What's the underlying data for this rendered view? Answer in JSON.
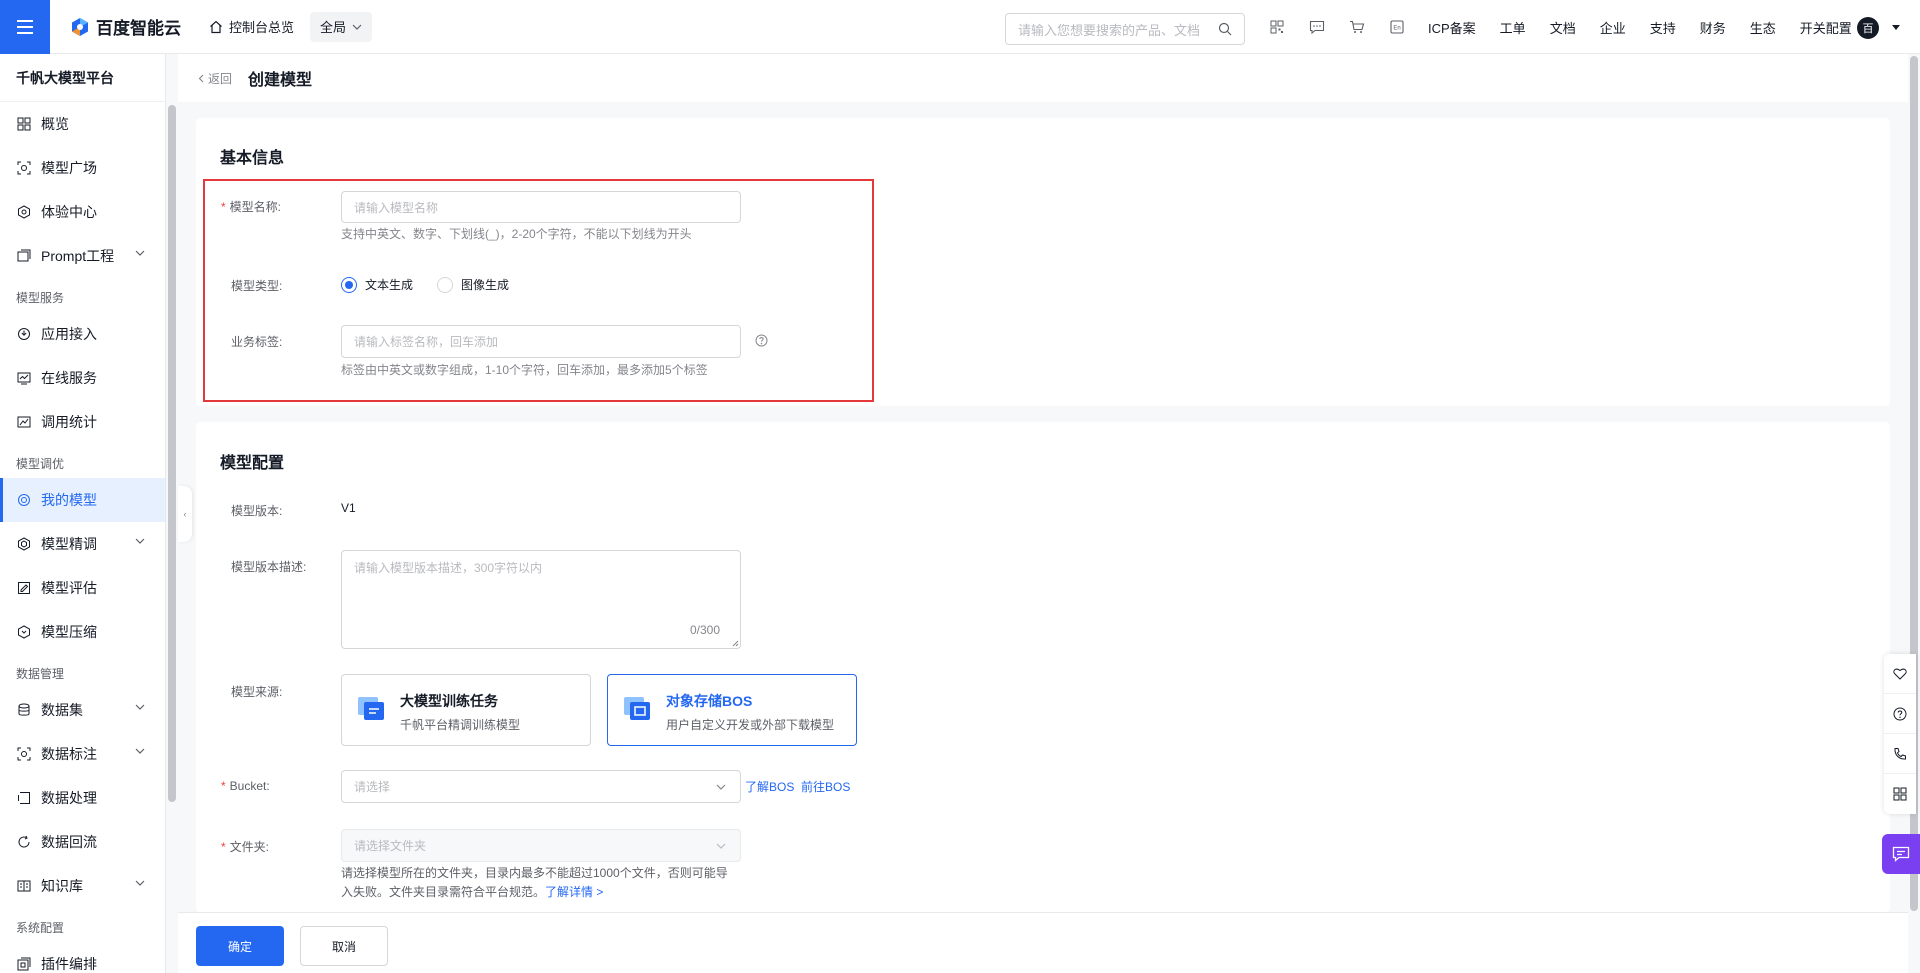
{
  "topbar": {
    "logo_text": "百度智能云",
    "console_label": "控制台总览",
    "scope_value": "全局",
    "search_placeholder": "请输入您想要搜索的产品、文档",
    "nav": [
      "ICP备案",
      "工单",
      "文档",
      "企业",
      "支持",
      "财务",
      "生态",
      "开关配置"
    ],
    "avatar_text": "百",
    "icons": [
      "qrcode-icon",
      "message-icon",
      "cart-icon",
      "language-icon"
    ]
  },
  "sidebar": {
    "title": "千帆大模型平台",
    "items": [
      {
        "label": "概览",
        "icon": "grid-icon"
      },
      {
        "label": "模型广场",
        "icon": "model-square-icon"
      },
      {
        "label": "体验中心",
        "icon": "experience-icon"
      },
      {
        "label": "Prompt工程",
        "icon": "prompt-icon",
        "expandable": true
      }
    ],
    "groups": [
      {
        "label": "模型服务",
        "items": [
          {
            "label": "应用接入",
            "icon": "app-access-icon"
          },
          {
            "label": "在线服务",
            "icon": "online-service-icon"
          },
          {
            "label": "调用统计",
            "icon": "statistics-icon"
          }
        ]
      },
      {
        "label": "模型调优",
        "items": [
          {
            "label": "我的模型",
            "icon": "my-model-icon",
            "active": true
          },
          {
            "label": "模型精调",
            "icon": "fine-tune-icon",
            "expandable": true
          },
          {
            "label": "模型评估",
            "icon": "evaluate-icon"
          },
          {
            "label": "模型压缩",
            "icon": "compress-icon"
          }
        ]
      },
      {
        "label": "数据管理",
        "items": [
          {
            "label": "数据集",
            "icon": "dataset-icon",
            "expandable": true
          },
          {
            "label": "数据标注",
            "icon": "annotation-icon",
            "expandable": true
          },
          {
            "label": "数据处理",
            "icon": "processing-icon"
          },
          {
            "label": "数据回流",
            "icon": "reflow-icon"
          },
          {
            "label": "知识库",
            "icon": "knowledge-icon",
            "expandable": true
          }
        ]
      },
      {
        "label": "系统配置",
        "items": [
          {
            "label": "插件编排",
            "icon": "plugin-icon"
          }
        ]
      }
    ]
  },
  "page": {
    "back_label": "返回",
    "title": "创建模型"
  },
  "basic_info": {
    "title": "基本信息",
    "name_label": "模型名称:",
    "name_placeholder": "请输入模型名称",
    "name_hint": "支持中英文、数字、下划线(_)，2-20个字符，不能以下划线为开头",
    "type_label": "模型类型:",
    "type_options": [
      "文本生成",
      "图像生成"
    ],
    "type_selected": "文本生成",
    "tag_label": "业务标签:",
    "tag_placeholder": "请输入标签名称，回车添加",
    "tag_hint": "标签由中英文或数字组成，1-10个字符，回车添加，最多添加5个标签"
  },
  "model_config": {
    "title": "模型配置",
    "version_label": "模型版本:",
    "version_value": "V1",
    "desc_label": "模型版本描述:",
    "desc_placeholder": "请输入模型版本描述，300字符以内",
    "desc_counter": "0/300",
    "source_label": "模型来源:",
    "sources": [
      {
        "title": "大模型训练任务",
        "desc": "千帆平台精调训练模型",
        "selected": false
      },
      {
        "title": "对象存储BOS",
        "desc": "用户自定义开发或外部下载模型",
        "selected": true
      }
    ],
    "bucket_label": "Bucket:",
    "bucket_placeholder": "请选择",
    "bucket_links": [
      "了解BOS",
      "前往BOS"
    ],
    "folder_label": "文件夹:",
    "folder_placeholder": "请选择文件夹",
    "folder_hint_line1": "请选择模型所在的文件夹，目录内最多不能超过1000个文件，否则可能导",
    "folder_hint_line2": "入失败。文件夹目录需符合平台规范。",
    "folder_hint_link": "了解详情 >"
  },
  "footer": {
    "confirm_label": "确定",
    "cancel_label": "取消"
  },
  "colors": {
    "primary": "#2468f2",
    "highlight": "#e5383b",
    "chat": "#7b3ff2"
  }
}
